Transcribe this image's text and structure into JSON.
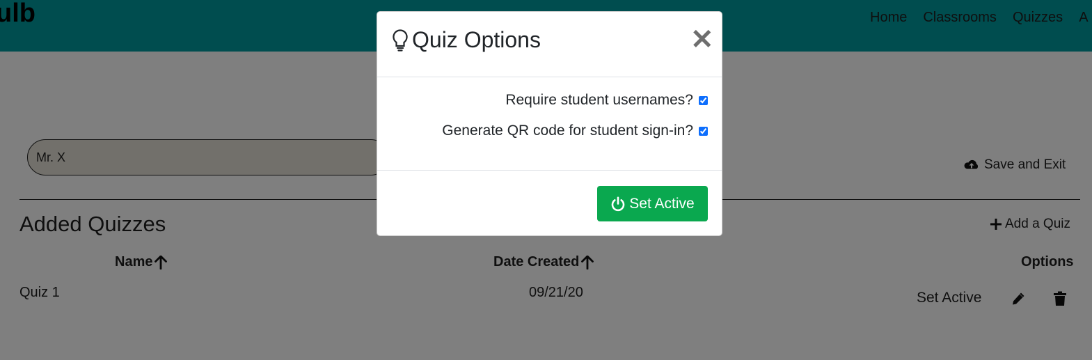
{
  "navbar": {
    "brand": "ulb",
    "links": [
      "Home",
      "Classrooms",
      "Quizzes",
      "A"
    ]
  },
  "form": {
    "teacher_name": "Mr. X",
    "save_exit_label": "Save and Exit"
  },
  "quizzes_section": {
    "title": "Added Quizzes",
    "add_label": "Add a Quiz",
    "columns": {
      "name": "Name",
      "date": "Date Created",
      "options": "Options"
    },
    "rows": [
      {
        "name": "Quiz 1",
        "date": "09/21/20",
        "set_active": "Set Active"
      }
    ]
  },
  "modal": {
    "title": "Quiz Options",
    "options": [
      {
        "label": "Require student usernames?",
        "checked": true
      },
      {
        "label": "Generate QR code for student sign-in?",
        "checked": true
      }
    ],
    "primary_button": "Set Active"
  },
  "colors": {
    "navbar": "#009a9f",
    "success": "#0aa84f",
    "checkbox": "#0d6efd"
  }
}
